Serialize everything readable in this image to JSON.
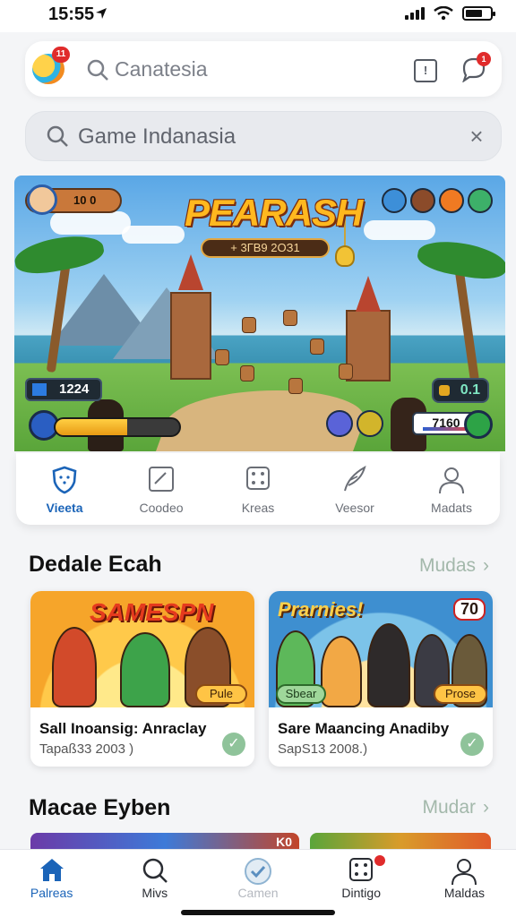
{
  "status_bar": {
    "time": "15:55"
  },
  "top_bar": {
    "logo_badge": "11",
    "search_text": "Canatesia",
    "chat_badge": "1"
  },
  "search": {
    "placeholder": "Game Indanasia"
  },
  "hero": {
    "title": "PEARASH",
    "subtitle": "+ 3ГВ9 2ОЗ1",
    "player_chip": "10 0",
    "score_left": "1224",
    "score_right": "0.1",
    "counter": "7160",
    "hp_fraction": 0.58
  },
  "categories": [
    {
      "label": "Vieeta",
      "icon": "shield-icon",
      "active": true
    },
    {
      "label": "Coodeo",
      "icon": "note-icon",
      "active": false
    },
    {
      "label": "Kreas",
      "icon": "dice-icon",
      "active": false
    },
    {
      "label": "Veesor",
      "icon": "feather-icon",
      "active": false
    },
    {
      "label": "Madats",
      "icon": "user-icon",
      "active": false
    }
  ],
  "sections": [
    {
      "title": "Dedale Ecah",
      "link": "Mudas",
      "cards": [
        {
          "thumb_title": "SAMESPN",
          "pill": "Pule",
          "title": "Sall Inoansig: Anraclay",
          "subtitle": "Tapaß33 2003 )"
        },
        {
          "thumb_title": "Prarnies!",
          "pill_left": "Sbear",
          "pill": "Prose",
          "badge": "70",
          "title": "Sare Maancing Anadiby",
          "subtitle": "SapS13 2008.)"
        }
      ]
    },
    {
      "title": "Macae Eyben",
      "link": "Mudar",
      "partial_badge": "K0"
    }
  ],
  "bottom_nav": [
    {
      "label": "Palreas",
      "icon": "home-icon",
      "state": "active"
    },
    {
      "label": "Mivs",
      "icon": "search-icon",
      "state": "normal"
    },
    {
      "label": "Camen",
      "icon": "check-circle-icon",
      "state": "disabled"
    },
    {
      "label": "Dintigo",
      "icon": "dice-icon",
      "state": "normal"
    },
    {
      "label": "Maldas",
      "icon": "user-icon",
      "state": "normal"
    }
  ],
  "colors": {
    "accent": "#1b64b8",
    "link": "#a3b8ab",
    "badge": "#e02b2b",
    "check": "#8fc39a"
  }
}
